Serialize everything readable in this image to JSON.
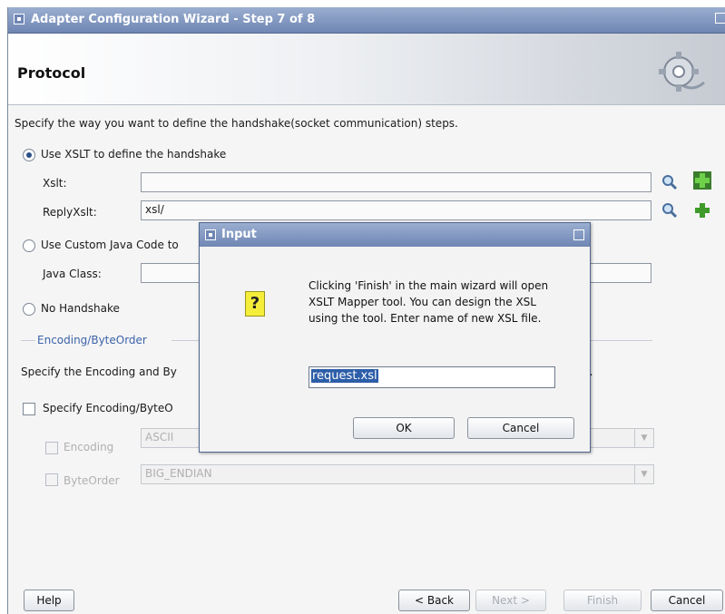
{
  "window": {
    "title": "Adapter Configuration Wizard - Step 7 of 8"
  },
  "header": {
    "title": "Protocol"
  },
  "description": "Specify the way you want to define the handshake(socket communication) steps.",
  "options": {
    "xslt_radio_label": "Use XSLT to define the handshake",
    "xslt_label": "Xslt:",
    "xslt_value": "",
    "reply_xslt_label": "ReplyXslt:",
    "reply_xslt_value": "xsl/",
    "custom_java_label": "Use Custom Java Code to",
    "java_class_label": "Java Class:",
    "java_class_value": "",
    "no_handshake_label": "No Handshake",
    "selected": "xslt"
  },
  "encoding_section": {
    "title": "Encoding/ByteOrder",
    "description_visible": "Specify the Encoding and By",
    "description_tail": "n.",
    "specify_checkbox_label": "Specify Encoding/ByteO",
    "encoding_label": "Encoding",
    "encoding_value": "ASCII",
    "byteorder_label": "ByteOrder",
    "byteorder_value": "BIG_ENDIAN"
  },
  "footer": {
    "help": "Help",
    "back": "< Back",
    "next": "Next >",
    "finish": "Finish",
    "cancel": "Cancel"
  },
  "dialog": {
    "title": "Input",
    "message": "Clicking 'Finish' in the main wizard will open XSLT Mapper tool. You can design the XSL using the tool. Enter name of new XSL file.",
    "input_value": "request.xsl",
    "ok": "OK",
    "cancel": "Cancel"
  },
  "icons": [
    "search-icon",
    "add-icon",
    "question-icon",
    "gear-plug-icon"
  ],
  "colors": {
    "titlebar": "#6f86b4",
    "section_title": "#3c63a8",
    "selection": "#2d5ea8"
  }
}
